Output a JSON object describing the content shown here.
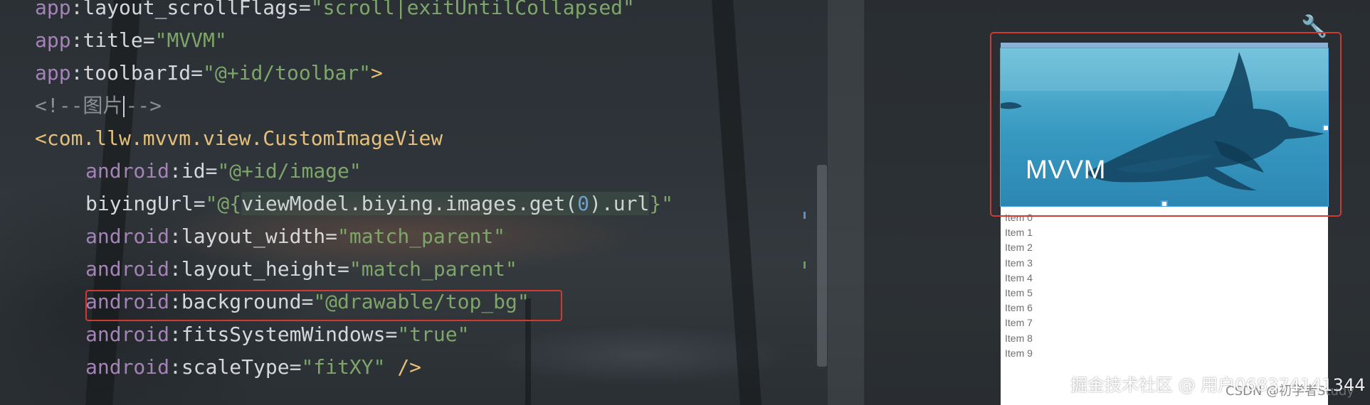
{
  "code": {
    "line1": {
      "ns": "app",
      "colon": ":",
      "attr": "layout_scrollFlags",
      "eq": "=",
      "value": "\"scroll|exitUntilCollapsed\""
    },
    "line2": {
      "ns": "app",
      "colon": ":",
      "attr": "title",
      "eq": "=",
      "value": "\"MVVM\""
    },
    "line3": {
      "ns": "app",
      "colon": ":",
      "attr": "toolbarId",
      "eq": "=",
      "value": "\"@+id/toolbar\"",
      "close": ">"
    },
    "line4": {
      "comment_before_caret": "<!--图片",
      "comment_after_caret": "-->"
    },
    "line5": {
      "tag": "<com.llw.mvvm.view.CustomImageView"
    },
    "line6": {
      "ns": "android",
      "colon": ":",
      "attr": "id",
      "eq": "=",
      "value": "\"@+id/image\""
    },
    "line7": {
      "attr": "biyingUrl",
      "eq": "=",
      "quote_open": "\"@{",
      "binding_a": "viewModel.biying.images.get(",
      "binding_num": "0",
      "binding_b": ").url",
      "quote_close": "}\""
    },
    "line8": {
      "ns": "android",
      "colon": ":",
      "attr": "layout_width",
      "eq": "=",
      "value": "\"match_parent\""
    },
    "line9": {
      "ns": "android",
      "colon": ":",
      "attr": "layout_height",
      "eq": "=",
      "value": "\"match_parent\""
    },
    "line10": {
      "ns": "android",
      "colon": ":",
      "attr": "background",
      "eq": "=",
      "value": "\"@drawable/top_bg\""
    },
    "line11": {
      "ns": "android",
      "colon": ":",
      "attr": "fitsSystemWindows",
      "eq": "=",
      "value": "\"true\""
    },
    "line12": {
      "ns": "android",
      "colon": ":",
      "attr": "scaleType",
      "eq": "=",
      "value": "\"fitXY\"",
      "close": " />"
    }
  },
  "preview": {
    "hero_title": "MVVM",
    "items": [
      "Item 0",
      "Item 1",
      "Item 2",
      "Item 3",
      "Item 4",
      "Item 5",
      "Item 6",
      "Item 7",
      "Item 8",
      "Item 9"
    ]
  },
  "icons": {
    "toolbar": "wrench-icon"
  },
  "colors": {
    "highlight_box": "#d03a32",
    "selection": "#4aa3e6",
    "string": "#7ea66a",
    "namespace": "#a583b8",
    "tag": "#e6c07b"
  },
  "watermark": {
    "main": "掘金技术社区 @ 用户068374141344",
    "sub": "CSDN @初学者Study"
  }
}
